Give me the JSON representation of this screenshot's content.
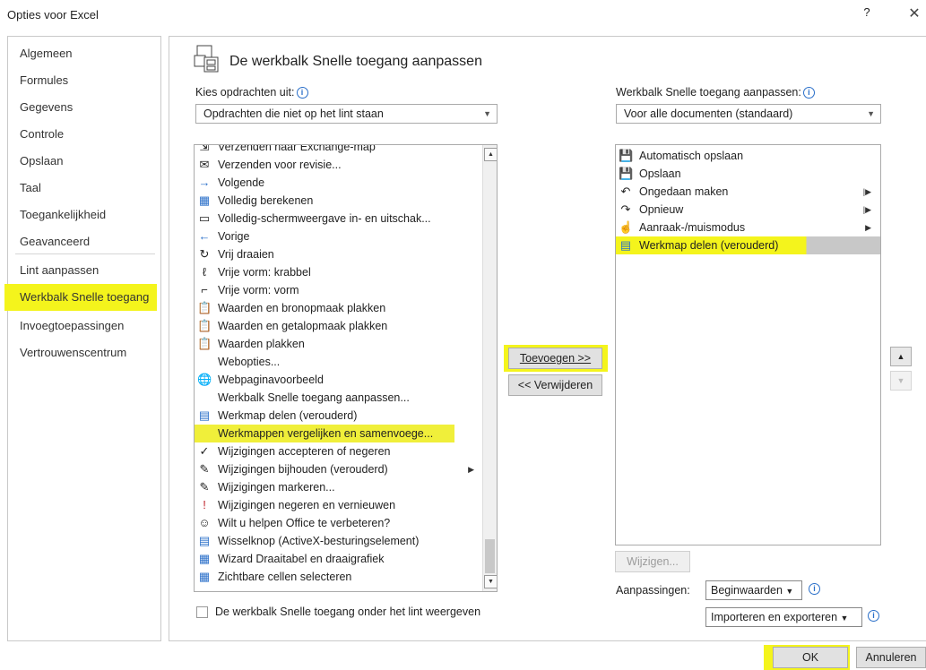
{
  "window": {
    "title": "Opties voor Excel",
    "help": "?",
    "close": "✕"
  },
  "nav": {
    "items": [
      {
        "label": "Algemeen"
      },
      {
        "label": "Formules"
      },
      {
        "label": "Gegevens"
      },
      {
        "label": "Controle"
      },
      {
        "label": "Opslaan"
      },
      {
        "label": "Taal"
      },
      {
        "label": "Toegankelijkheid"
      },
      {
        "label": "Geavanceerd"
      },
      {
        "label": "Lint aanpassen"
      },
      {
        "label": "Werkbalk Snelle toegang",
        "selected": true
      },
      {
        "label": "Invoegtoepassingen"
      },
      {
        "label": "Vertrouwenscentrum"
      }
    ]
  },
  "main": {
    "title": "De werkbalk Snelle toegang aanpassen",
    "choose_label": "Kies opdrachten uit:",
    "choose_value": "Opdrachten die niet op het lint staan",
    "customize_label": "Werkbalk Snelle toegang aanpassen:",
    "customize_value": "Voor alle documenten (standaard)",
    "info": "i",
    "commands": [
      {
        "label": "Verzenden naar Exchange-map",
        "icon": "send-folder-icon",
        "glyph": "⇲"
      },
      {
        "label": "Verzenden voor revisie...",
        "icon": "send-review-icon",
        "glyph": "✉"
      },
      {
        "label": "Volgende",
        "icon": "arrow-right-icon",
        "glyph": "→"
      },
      {
        "label": "Volledig berekenen",
        "icon": "calculator-icon",
        "glyph": "▦"
      },
      {
        "label": "Volledig-schermweergave in- en uitschak...",
        "icon": "fullscreen-icon",
        "glyph": "▭"
      },
      {
        "label": "Vorige",
        "icon": "arrow-left-icon",
        "glyph": "←"
      },
      {
        "label": "Vrij draaien",
        "icon": "rotate-icon",
        "glyph": "↻"
      },
      {
        "label": "Vrije vorm: krabbel",
        "icon": "scribble-icon",
        "glyph": "ℓ"
      },
      {
        "label": "Vrije vorm: vorm",
        "icon": "freeform-icon",
        "glyph": "⌐"
      },
      {
        "label": "Waarden en bronopmaak plakken",
        "icon": "paste-source-icon",
        "glyph": "📋"
      },
      {
        "label": "Waarden en getalopmaak plakken",
        "icon": "paste-number-icon",
        "glyph": "📋"
      },
      {
        "label": "Waarden plakken",
        "icon": "paste-values-icon",
        "glyph": "📋"
      },
      {
        "label": "Webopties...",
        "icon": "",
        "glyph": ""
      },
      {
        "label": "Webpaginavoorbeeld",
        "icon": "web-preview-icon",
        "glyph": "🌐"
      },
      {
        "label": "Werkbalk Snelle toegang aanpassen...",
        "icon": "",
        "glyph": ""
      },
      {
        "label": "Werkmap delen (verouderd)",
        "icon": "share-workbook-icon",
        "glyph": "▤"
      },
      {
        "label": "Werkmappen vergelijken en samenvoege...",
        "icon": "",
        "glyph": "",
        "selected": true
      },
      {
        "label": "Wijzigingen accepteren of negeren",
        "icon": "accept-changes-icon",
        "glyph": "✓"
      },
      {
        "label": "Wijzigingen bijhouden (verouderd)",
        "icon": "track-changes-icon",
        "glyph": "✎",
        "submenu": true
      },
      {
        "label": "Wijzigingen markeren...",
        "icon": "highlight-changes-icon",
        "glyph": "✎"
      },
      {
        "label": "Wijzigingen negeren en vernieuwen",
        "icon": "discard-changes-icon",
        "glyph": "!"
      },
      {
        "label": "Wilt u helpen Office te verbeteren?",
        "icon": "smiley-icon",
        "glyph": "☺"
      },
      {
        "label": "Wisselknop (ActiveX-besturingselement)",
        "icon": "toggle-button-icon",
        "glyph": "▤"
      },
      {
        "label": "Wizard Draaitabel en draaigrafiek",
        "icon": "pivot-wizard-icon",
        "glyph": "▦"
      },
      {
        "label": "Zichtbare cellen selecteren",
        "icon": "visible-cells-icon",
        "glyph": "▦"
      }
    ],
    "toolbar_items": [
      {
        "label": "Automatisch opslaan",
        "icon": "autosave-icon",
        "glyph": "💾"
      },
      {
        "label": "Opslaan",
        "icon": "save-icon",
        "glyph": "💾"
      },
      {
        "label": "Ongedaan maken",
        "icon": "undo-icon",
        "glyph": "↶",
        "submenu_bar": true
      },
      {
        "label": "Opnieuw",
        "icon": "redo-icon",
        "glyph": "↷",
        "submenu_bar": true
      },
      {
        "label": "Aanraak-/muismodus",
        "icon": "touch-mode-icon",
        "glyph": "☝",
        "submenu": true
      },
      {
        "label": "Werkmap delen (verouderd)",
        "icon": "share-workbook-icon",
        "glyph": "▤",
        "selected": true
      }
    ],
    "add_button": "Toevoegen >>",
    "remove_button": "<< Verwijderen",
    "modify_button": "Wijzigen...",
    "customizations_label": "Aanpassingen:",
    "reset_button": "Beginwaarden",
    "import_export_button": "Importeren en exporteren",
    "show_below_label": "De werkbalk Snelle toegang onder het lint weergeven",
    "show_below_checked": false
  },
  "footer": {
    "ok": "OK",
    "cancel": "Annuleren"
  },
  "colors": {
    "highlight": "#f4f41c",
    "selection": "#d8d8d8",
    "accent": "#2a6fc9"
  }
}
